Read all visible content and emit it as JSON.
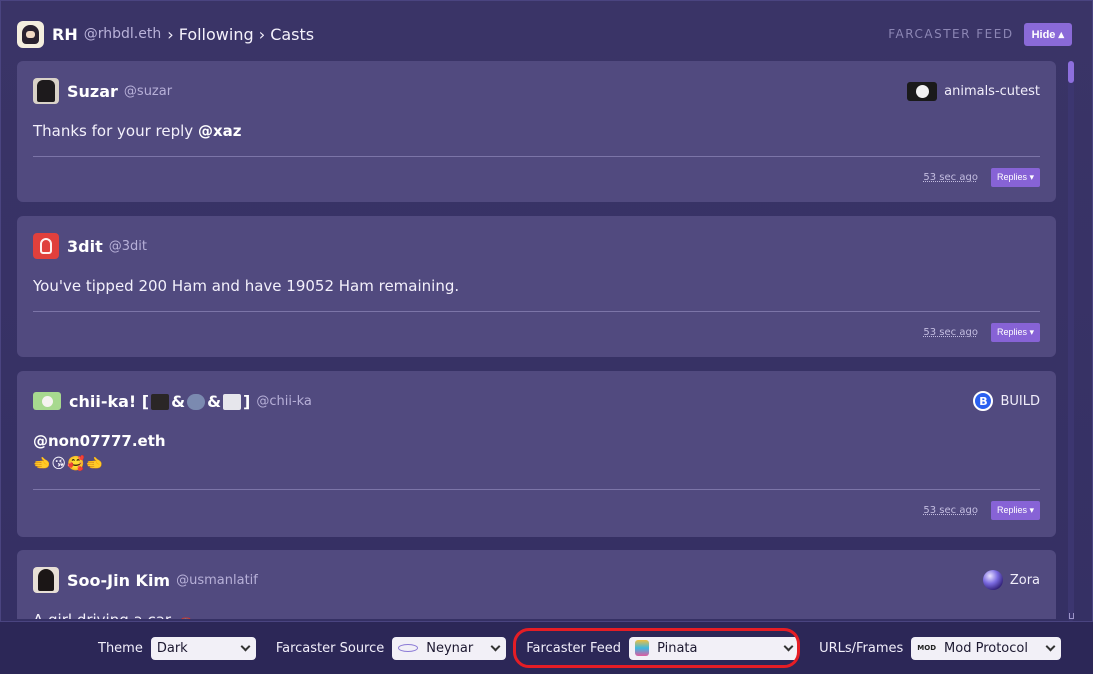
{
  "header": {
    "user_name": "RH",
    "user_handle": "@rhbdl.eth",
    "breadcrumb": "› Following › Casts",
    "feed_title": "FARCASTER FEED",
    "hide_label": "Hide ▴"
  },
  "casts": [
    {
      "author": "Suzar",
      "handle": "@suzar",
      "channel": "animals-cutest",
      "text_prefix": "Thanks for your reply ",
      "mention": "@xaz",
      "timestamp": "53 sec ago",
      "replies_label": "Replies ▾"
    },
    {
      "author": "3dit",
      "handle": "@3dit",
      "text": "You've tipped 200 Ham and have 19052 Ham remaining.",
      "timestamp": "53 sec ago",
      "replies_label": "Replies ▾"
    },
    {
      "author_prefix": "chii-ka! [",
      "author_amp1": "&",
      "author_amp2": "&",
      "author_suffix": "]",
      "handle": "@chii-ka",
      "channel": "BUILD",
      "mention": "@non07777.eth",
      "emojis": "🫲😘🥰🫲",
      "timestamp": "53 sec ago",
      "replies_label": "Replies ▾"
    },
    {
      "author": "Soo-Jin Kim",
      "handle": "@usmanlatif",
      "channel": "Zora",
      "text": "A girl driving a car 🚗"
    }
  ],
  "settings": {
    "theme": {
      "label": "Theme",
      "value": "Dark"
    },
    "source": {
      "label": "Farcaster Source",
      "value": "Neynar"
    },
    "feed": {
      "label": "Farcaster Feed",
      "value": "Pinata"
    },
    "urls": {
      "label": "URLs/Frames",
      "value": "Mod Protocol",
      "icon_text": "MOD"
    }
  },
  "colors": {
    "accent": "#8a6ad8",
    "card_bg": "#514a7f",
    "highlight": "#e51d25"
  }
}
